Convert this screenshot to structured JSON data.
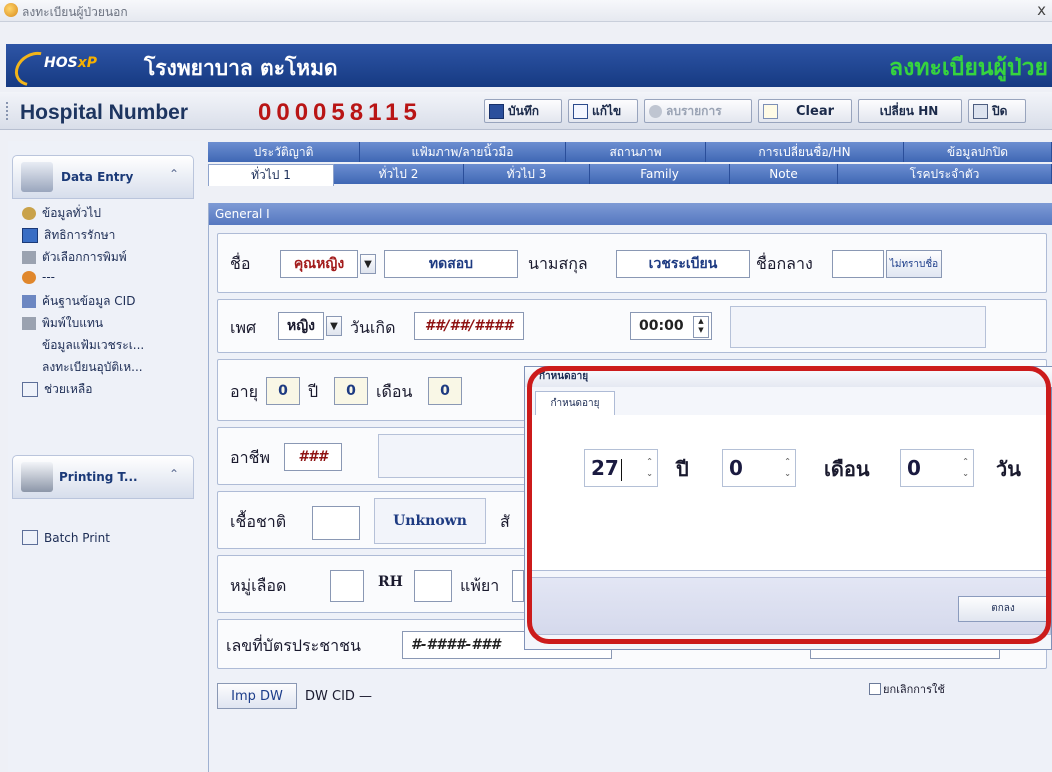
{
  "window": {
    "title": "ลงทะเบียนผู้ป่วยนอก",
    "close": "x"
  },
  "header": {
    "logo_text_a": "HOS",
    "logo_text_b": "xP",
    "hospital_name": "โรงพยาบาล ตะโหมด",
    "module_title": "ลงทะเบียนผู้ป่วย"
  },
  "toolbar": {
    "hn_label": "Hospital Number",
    "hn_value": "000058115",
    "save": "บันทึก",
    "edit": "แก้ไข",
    "delete": "ลบรายการ",
    "clear": "Clear",
    "change_hn": "เปลี่ยน HN",
    "close": "ปิด"
  },
  "sidebar": {
    "group1": "Data Entry",
    "items": [
      "ข้อมูลทั่วไป",
      "สิทธิการรักษา",
      "ตัวเลือกการพิมพ์",
      "---",
      "ค้นฐานข้อมูล CID",
      "พิมพ์ใบแทน",
      "ข้อมูลแฟ้มเวชระเ...",
      "ลงทะเบียนอุบัติเห...",
      "ช่วยเหลือ"
    ],
    "group2": "Printing T...",
    "items2": [
      "Batch Print"
    ]
  },
  "tabs_row1": [
    "ประวัติญาติ",
    "แฟ้มภาพ/ลายนิ้วมือ",
    "สถานภาพ",
    "การเปลี่ยนชื่อ/HN",
    "ข้อมูลปกปิด"
  ],
  "tabs_row2": [
    "ทั่วไป 1",
    "ทั่วไป 2",
    "ทั่วไป 3",
    "Family",
    "Note",
    "โรคประจำตัว"
  ],
  "general": {
    "header": "General I",
    "name_label": "ชื่อ",
    "prefix": "คุณหญิง",
    "first_name": "ทดสอบ",
    "lastname_label": "นามสกุล",
    "last_name": "เวชระเบียน",
    "middle_label": "ชื่อกลาง",
    "unknown_name_btn": "ไม่ทราบชื่อ",
    "sex_label": "เพศ",
    "sex": "หญิง",
    "birth_label": "วันเกิด",
    "birth_date": "##/##/####",
    "birth_time": "00:00",
    "age_label": "อายุ",
    "age_year": "0",
    "year_label": "ปี",
    "age_month": "0",
    "month_label": "เดือน",
    "age_day": "0",
    "occupation_label": "อาชีพ",
    "occupation": "###",
    "nation_label": "เชื้อชาติ",
    "nation_value": "Unknown",
    "nation_after": "สั",
    "blood_label": "หมู่เลือด",
    "rh_label": "RH",
    "allergy_label": "แพ้ยา",
    "cid_label": "เลขที่บัตรประชาชน",
    "cid_value": "#-####-###",
    "cancel_use": "ยกเลิกการใช้",
    "imp_btn": "Imp DW",
    "dw_cid": "DW CID —"
  },
  "dialog": {
    "title": "กำหนดอายุ",
    "tab": "กำหนดอายุ",
    "years": "27",
    "year_unit": "ปี",
    "months": "0",
    "month_unit": "เดือน",
    "days": "0",
    "day_unit": "วัน",
    "ok": "ตกลง"
  }
}
